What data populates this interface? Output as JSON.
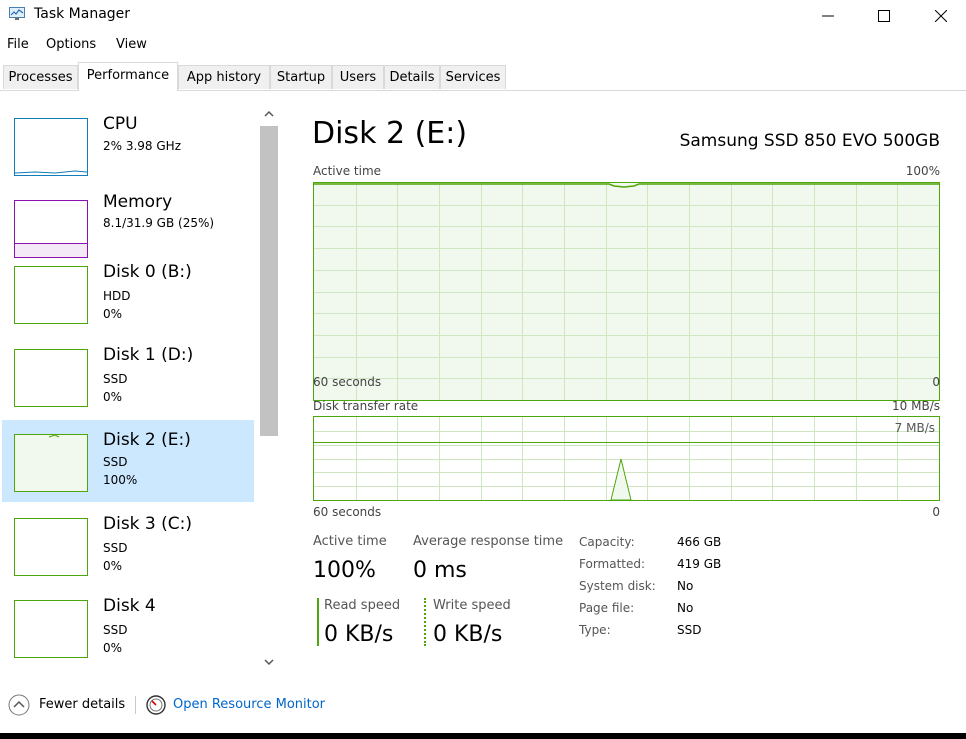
{
  "window": {
    "title": "Task Manager"
  },
  "menu": [
    "File",
    "Options",
    "View"
  ],
  "tabs": [
    "Processes",
    "Performance",
    "App history",
    "Startup",
    "Users",
    "Details",
    "Services"
  ],
  "active_tab": "Performance",
  "sidebar": [
    {
      "name": "CPU",
      "line1": "2% 3.98 GHz",
      "line2": ""
    },
    {
      "name": "Memory",
      "line1": "8.1/31.9 GB (25%)",
      "line2": ""
    },
    {
      "name": "Disk 0 (B:)",
      "line1": "HDD",
      "line2": "0%"
    },
    {
      "name": "Disk 1 (D:)",
      "line1": "SSD",
      "line2": "0%"
    },
    {
      "name": "Disk 2 (E:)",
      "line1": "SSD",
      "line2": "100%"
    },
    {
      "name": "Disk 3 (C:)",
      "line1": "SSD",
      "line2": "0%"
    },
    {
      "name": "Disk 4",
      "line1": "SSD",
      "line2": "0%"
    }
  ],
  "colors": {
    "disk": "#4da60c",
    "disk_fill": "#f1f9ee",
    "cpu": "#117dbb",
    "memory": "#8b12ae",
    "selected": "#cce8ff",
    "link": "#0066cc"
  },
  "main": {
    "title": "Disk 2 (E:)",
    "model": "Samsung SSD 850 EVO 500GB",
    "active_graph": {
      "label": "Active time",
      "max": "100%",
      "time": "60 seconds",
      "min": "0"
    },
    "transfer_graph": {
      "label": "Disk transfer rate",
      "max": "10 MB/s",
      "marker": "7 MB/s",
      "time": "60 seconds",
      "min": "0"
    },
    "stats": {
      "active_time_label": "Active time",
      "active_time_value": "100%",
      "avg_response_label": "Average response time",
      "avg_response_value": "0 ms",
      "read_label": "Read speed",
      "read_value": "0 KB/s",
      "write_label": "Write speed",
      "write_value": "0 KB/s"
    },
    "props": [
      {
        "label": "Capacity:",
        "value": "466 GB"
      },
      {
        "label": "Formatted:",
        "value": "419 GB"
      },
      {
        "label": "System disk:",
        "value": "No"
      },
      {
        "label": "Page file:",
        "value": "No"
      },
      {
        "label": "Type:",
        "value": "SSD"
      }
    ]
  },
  "footer": {
    "fewer": "Fewer details",
    "monitor": "Open Resource Monitor"
  },
  "icons": [
    "task-manager-icon",
    "minimize-icon",
    "maximize-icon",
    "close-icon",
    "scroll-up-icon",
    "scroll-down-icon",
    "chevron-up-circle-icon",
    "resource-monitor-icon"
  ]
}
